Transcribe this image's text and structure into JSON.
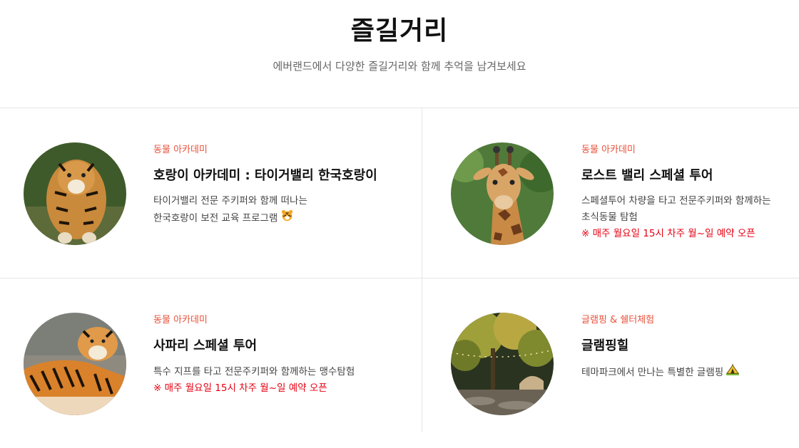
{
  "header": {
    "title": "즐길거리",
    "subtitle": "에버랜드에서 다양한 즐길거리와 함께 추억을 남겨보세요"
  },
  "cards": [
    {
      "category": "동물 아카데미",
      "name": "호랑이 아카데미 : 타이거밸리 한국호랑이",
      "desc_line1": "타이거밸리 전문 주키퍼와 함께 떠나는",
      "desc_line2": "한국호랑이 보전 교육 프로그램",
      "emoji": "tiger-face-icon"
    },
    {
      "category": "동물 아카데미",
      "name": "로스트 밸리 스페셜 투어",
      "desc_line1": "스페셜투어 차량을 타고 전문주키퍼와 함께하는",
      "desc_line2": "초식동물 탐험",
      "notice": "※ 매주 월요일 15시 차주 월~일 예약 오픈"
    },
    {
      "category": "동물 아카데미",
      "name": "사파리 스페셜 투어",
      "desc_line1": "특수 지프를 타고 전문주키퍼와 함께하는 맹수탐험",
      "notice": "※ 매주 월요일 15시 차주 월~일 예약 오픈"
    },
    {
      "category": "글램핑 & 쉘터체험",
      "name": "글램핑힐",
      "desc_line1": "테마파크에서 만나는 특별한 글램핑",
      "emoji": "camping-tent-icon"
    }
  ],
  "colors": {
    "accent": "#e8513b",
    "notice": "#e60012",
    "divider": "#e6e6e6"
  }
}
